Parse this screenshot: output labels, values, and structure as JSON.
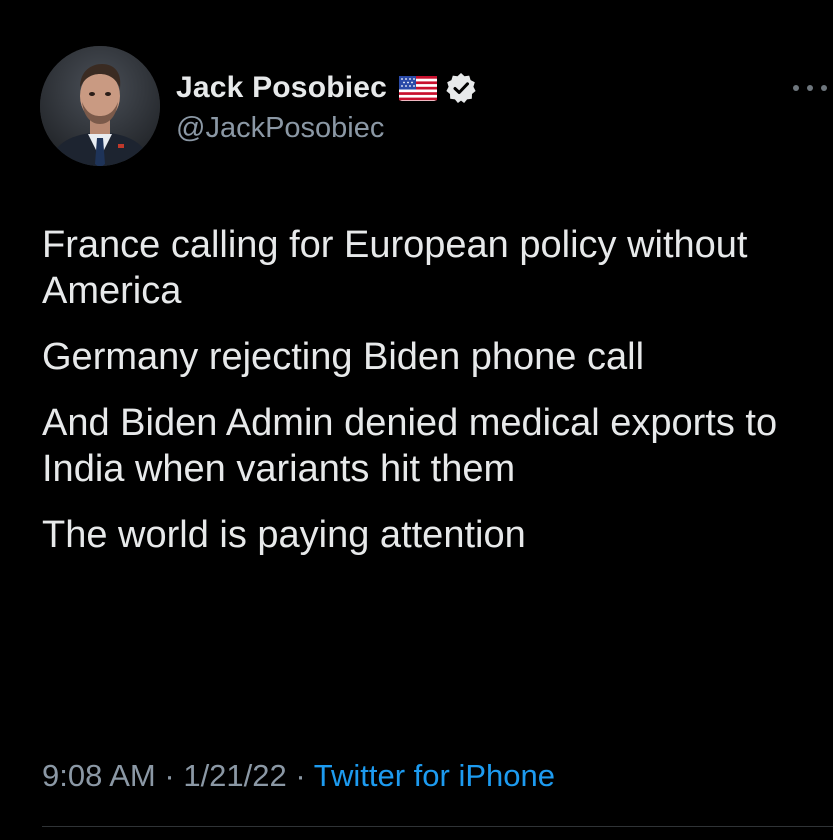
{
  "author": {
    "display_name": "Jack Posobiec",
    "handle": "@JackPosobiec",
    "avatar_icon": "profile-photo",
    "flag_icon": "us-flag-icon",
    "verified_icon": "verified-badge-icon"
  },
  "tweet": {
    "paragraphs": [
      "France calling for European policy without America",
      "Germany rejecting Biden phone call",
      "And Biden Admin denied medical exports to India when variants hit them",
      "The world is paying attention"
    ],
    "time": "9:08 AM",
    "separator": "·",
    "date": "1/21/22",
    "source": "Twitter for iPhone"
  },
  "menu": {
    "more_icon": "more-options-icon"
  },
  "colors": {
    "background": "#000000",
    "text_primary": "#e7e9ea",
    "text_secondary": "#8b98a5",
    "link": "#1d9bf0",
    "divider": "#2f3336"
  }
}
